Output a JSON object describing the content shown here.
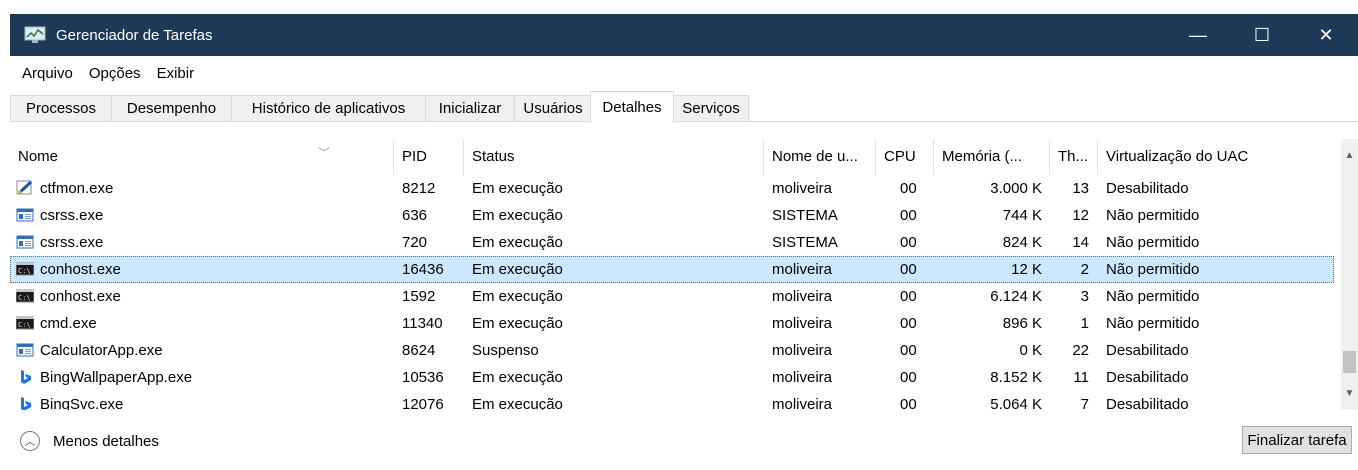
{
  "window": {
    "title": "Gerenciador de Tarefas",
    "controls": {
      "minimize": "—",
      "maximize": "☐",
      "close": "✕"
    },
    "colors": {
      "titlebar": "#1f3a57",
      "selection": "#cce8ff"
    }
  },
  "menu": [
    "Arquivo",
    "Opções",
    "Exibir"
  ],
  "tabs": [
    "Processos",
    "Desempenho",
    "Histórico de aplicativos",
    "Inicializar",
    "Usuários",
    "Detalhes",
    "Serviços"
  ],
  "active_tab": "Detalhes",
  "columns": [
    "Nome",
    "PID",
    "Status",
    "Nome de u...",
    "CPU",
    "Memória (...",
    "Th...",
    "Virtualização do UAC"
  ],
  "rows": [
    {
      "name": "ctfmon.exe",
      "pid": "8212",
      "status": "Em execução",
      "user": "moliveira",
      "cpu": "00",
      "mem": "3.000 K",
      "threads": "13",
      "uac": "Desabilitado",
      "icon": "ctfmon-icon"
    },
    {
      "name": "csrss.exe",
      "pid": "636",
      "status": "Em execução",
      "user": "SISTEMA",
      "cpu": "00",
      "mem": "744 K",
      "threads": "12",
      "uac": "Não permitido",
      "icon": "window-icon"
    },
    {
      "name": "csrss.exe",
      "pid": "720",
      "status": "Em execução",
      "user": "SISTEMA",
      "cpu": "00",
      "mem": "824 K",
      "threads": "14",
      "uac": "Não permitido",
      "icon": "window-icon"
    },
    {
      "name": "conhost.exe",
      "pid": "16436",
      "status": "Em execução",
      "user": "moliveira",
      "cpu": "00",
      "mem": "12 K",
      "threads": "2",
      "uac": "Não permitido",
      "icon": "console-icon",
      "selected": true
    },
    {
      "name": "conhost.exe",
      "pid": "1592",
      "status": "Em execução",
      "user": "moliveira",
      "cpu": "00",
      "mem": "6.124 K",
      "threads": "3",
      "uac": "Não permitido",
      "icon": "console-icon"
    },
    {
      "name": "cmd.exe",
      "pid": "11340",
      "status": "Em execução",
      "user": "moliveira",
      "cpu": "00",
      "mem": "896 K",
      "threads": "1",
      "uac": "Não permitido",
      "icon": "console-icon"
    },
    {
      "name": "CalculatorApp.exe",
      "pid": "8624",
      "status": "Suspenso",
      "user": "moliveira",
      "cpu": "00",
      "mem": "0 K",
      "threads": "22",
      "uac": "Desabilitado",
      "icon": "window-icon"
    },
    {
      "name": "BingWallpaperApp.exe",
      "pid": "10536",
      "status": "Em execução",
      "user": "moliveira",
      "cpu": "00",
      "mem": "8.152 K",
      "threads": "11",
      "uac": "Desabilitado",
      "icon": "bing-icon"
    },
    {
      "name": "BingSvc.exe",
      "pid": "12076",
      "status": "Em execução",
      "user": "moliveira",
      "cpu": "00",
      "mem": "5.064 K",
      "threads": "7",
      "uac": "Desabilitado",
      "icon": "bing-icon"
    }
  ],
  "footer": {
    "less_details": "Menos detalhes",
    "end_task": "Finalizar tarefa"
  }
}
